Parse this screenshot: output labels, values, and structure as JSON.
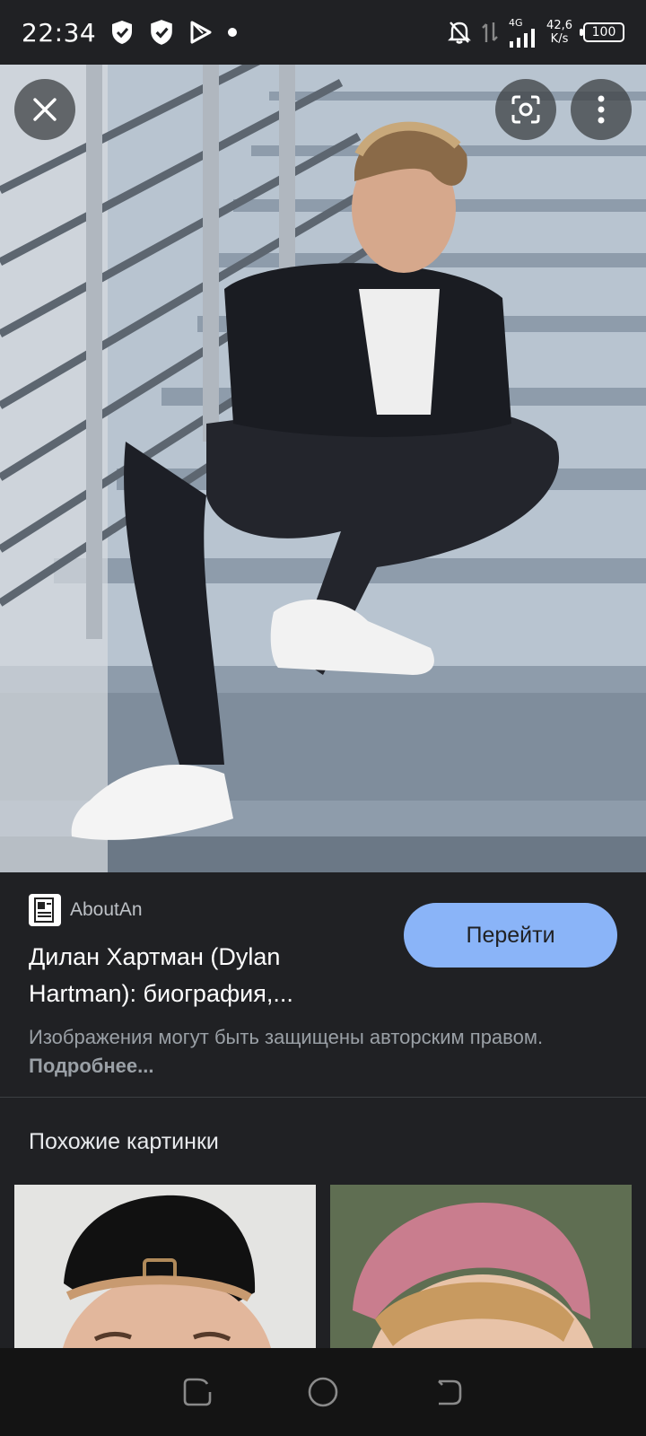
{
  "status_bar": {
    "time": "22:34",
    "network_type": "4G",
    "net_speed_value": "42,6",
    "net_speed_unit": "K/s",
    "battery": "100"
  },
  "viewer": {
    "icons": [
      "close-icon",
      "lens-icon",
      "more-vert-icon"
    ]
  },
  "result": {
    "source": "AboutAn",
    "title": "Дилан Хартман (Dylan Hartman): биография,...",
    "goto_label": "Перейти",
    "copyright_text": "Изображения могут быть защищены авторским правом.",
    "more_link": "Подробнее..."
  },
  "similar": {
    "title": "Похожие картинки"
  }
}
